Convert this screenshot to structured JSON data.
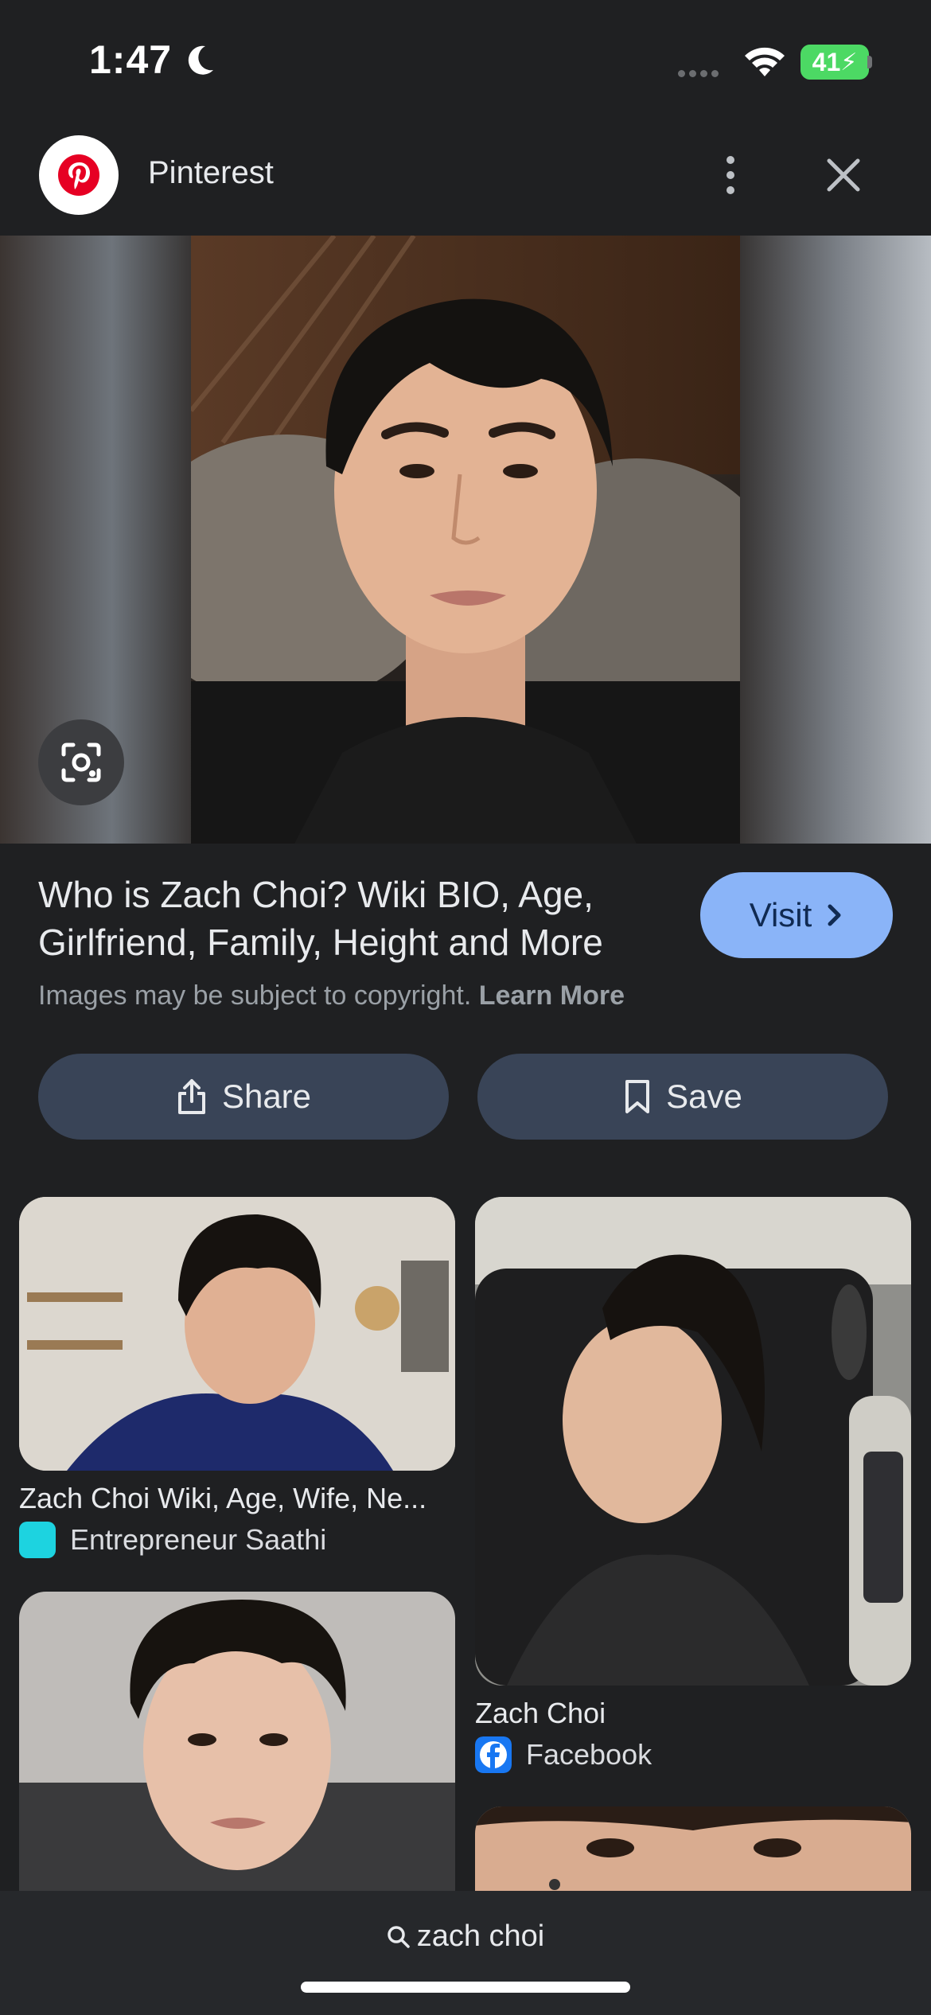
{
  "status_bar": {
    "time": "1:47",
    "battery": "41"
  },
  "header": {
    "site_name": "Pinterest",
    "logo_icon": "pinterest-logo",
    "menu_icon": "more-vert-icon",
    "close_icon": "close-icon"
  },
  "result": {
    "title": "Who is Zach Choi? Wiki BIO, Age, Girlfriend, Family, Height and More",
    "visit_label": "Visit",
    "copyright_text": "Images may be subject to copyright.",
    "learn_more": "Learn More",
    "share_label": "Share",
    "save_label": "Save"
  },
  "related": [
    {
      "title": "Zach Choi Wiki, Age, Wife, Ne...",
      "source": "Entrepreneur Saathi",
      "icon_color": "#1dd3e0"
    },
    {
      "title": "Zach Choi",
      "source": "Facebook",
      "icon_color": "#1877f2"
    }
  ],
  "search": {
    "query": "zach choi"
  },
  "colors": {
    "background": "#1f2022",
    "accent": "#8ab4f8",
    "button_bg": "#394457"
  }
}
